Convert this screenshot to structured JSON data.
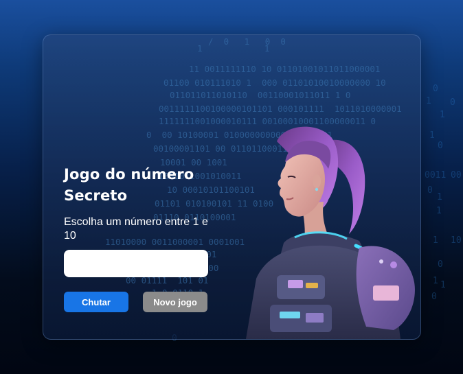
{
  "game": {
    "title": "Jogo do número Secreto",
    "instruction": "Escolha um número entre 1 e 10",
    "input_value": "",
    "guess_button": "Chutar",
    "new_game_button": "Novo jogo"
  },
  "illustration": {
    "subject": "astronaut-girl-illustration"
  },
  "colors": {
    "primary_button": "#1875e6",
    "secondary_button": "#8b8b8b",
    "background_top": "#1a4f9e",
    "background_bottom": "#010612"
  }
}
